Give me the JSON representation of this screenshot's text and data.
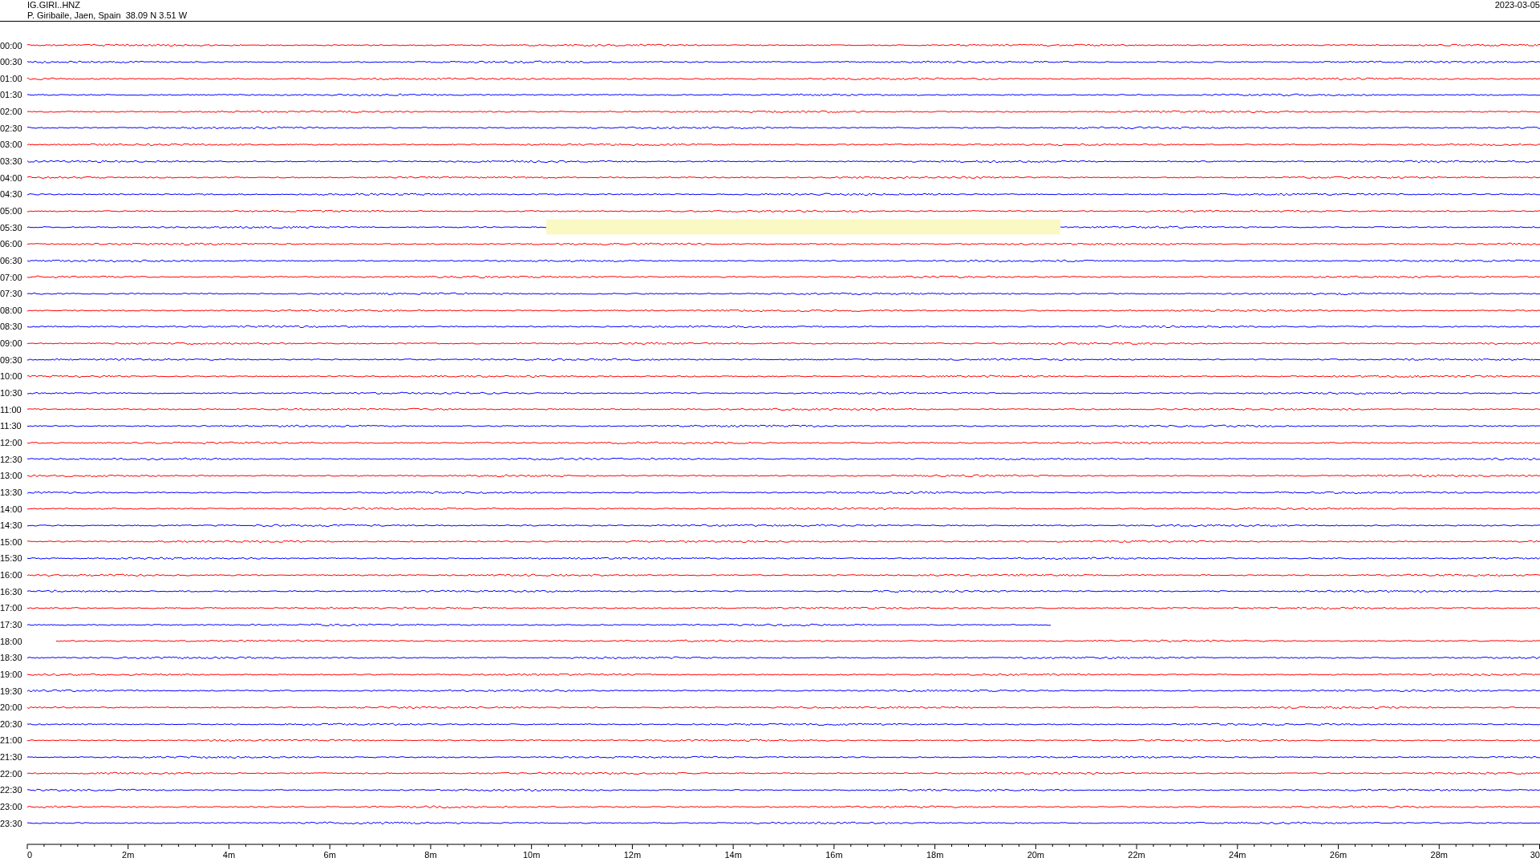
{
  "header": {
    "station": "IG.GIRI..HNZ",
    "location": "P. Giribaile, Jaen, Spain  38.09 N 3.51 W",
    "date": "2023-03-05"
  },
  "rows": [
    {
      "label": "00:00",
      "color": "#ff0000",
      "kind": "full",
      "highlighted": false
    },
    {
      "label": "00:30",
      "color": "#0000ff",
      "kind": "full",
      "highlighted": false
    },
    {
      "label": "01:00",
      "color": "#ff0000",
      "kind": "full",
      "highlighted": false
    },
    {
      "label": "01:30",
      "color": "#0000ff",
      "kind": "full",
      "highlighted": false
    },
    {
      "label": "02:00",
      "color": "#ff0000",
      "kind": "full",
      "highlighted": false
    },
    {
      "label": "02:30",
      "color": "#0000ff",
      "kind": "full",
      "highlighted": false
    },
    {
      "label": "03:00",
      "color": "#ff0000",
      "kind": "full",
      "highlighted": false
    },
    {
      "label": "03:30",
      "color": "#0000ff",
      "kind": "full",
      "highlighted": false
    },
    {
      "label": "04:00",
      "color": "#ff0000",
      "kind": "full",
      "highlighted": false
    },
    {
      "label": "04:30",
      "color": "#0000ff",
      "kind": "full",
      "highlighted": false
    },
    {
      "label": "05:00",
      "color": "#ff0000",
      "kind": "full",
      "highlighted": false
    },
    {
      "label": "05:30",
      "color": "#0000ff",
      "kind": "full",
      "highlighted": true
    },
    {
      "label": "06:00",
      "color": "#ff0000",
      "kind": "full",
      "highlighted": false
    },
    {
      "label": "06:30",
      "color": "#0000ff",
      "kind": "full",
      "highlighted": false
    },
    {
      "label": "07:00",
      "color": "#ff0000",
      "kind": "full",
      "highlighted": false
    },
    {
      "label": "07:30",
      "color": "#0000ff",
      "kind": "full",
      "highlighted": false
    },
    {
      "label": "08:00",
      "color": "#ff0000",
      "kind": "full",
      "highlighted": false
    },
    {
      "label": "08:30",
      "color": "#0000ff",
      "kind": "full",
      "highlighted": false
    },
    {
      "label": "09:00",
      "color": "#ff0000",
      "kind": "full",
      "highlighted": false
    },
    {
      "label": "09:30",
      "color": "#0000ff",
      "kind": "full",
      "highlighted": false
    },
    {
      "label": "10:00",
      "color": "#ff0000",
      "kind": "full",
      "highlighted": false
    },
    {
      "label": "10:30",
      "color": "#0000ff",
      "kind": "full",
      "highlighted": false
    },
    {
      "label": "11:00",
      "color": "#ff0000",
      "kind": "full",
      "highlighted": false
    },
    {
      "label": "11:30",
      "color": "#0000ff",
      "kind": "full",
      "highlighted": false
    },
    {
      "label": "12:00",
      "color": "#ff0000",
      "kind": "full",
      "highlighted": false
    },
    {
      "label": "12:30",
      "color": "#0000ff",
      "kind": "full",
      "highlighted": false
    },
    {
      "label": "13:00",
      "color": "#ff0000",
      "kind": "full",
      "highlighted": false
    },
    {
      "label": "13:30",
      "color": "#0000ff",
      "kind": "full",
      "highlighted": false
    },
    {
      "label": "14:00",
      "color": "#ff0000",
      "kind": "full",
      "highlighted": false
    },
    {
      "label": "14:30",
      "color": "#0000ff",
      "kind": "full",
      "highlighted": false
    },
    {
      "label": "15:00",
      "color": "#ff0000",
      "kind": "full",
      "highlighted": false
    },
    {
      "label": "15:30",
      "color": "#0000ff",
      "kind": "full",
      "highlighted": false
    },
    {
      "label": "16:00",
      "color": "#ff0000",
      "kind": "full",
      "highlighted": false
    },
    {
      "label": "16:30",
      "color": "#0000ff",
      "kind": "full",
      "highlighted": false
    },
    {
      "label": "17:00",
      "color": "#ff0000",
      "kind": "full",
      "highlighted": false
    },
    {
      "label": "17:30",
      "color": "#0000ff",
      "kind": "ends-early",
      "highlighted": false
    },
    {
      "label": "18:00",
      "color": "#ff0000",
      "kind": "starts-late",
      "highlighted": false
    },
    {
      "label": "18:30",
      "color": "#0000ff",
      "kind": "full",
      "highlighted": false
    },
    {
      "label": "19:00",
      "color": "#ff0000",
      "kind": "full",
      "highlighted": false
    },
    {
      "label": "19:30",
      "color": "#0000ff",
      "kind": "full",
      "highlighted": false
    },
    {
      "label": "20:00",
      "color": "#ff0000",
      "kind": "full",
      "highlighted": false
    },
    {
      "label": "20:30",
      "color": "#0000ff",
      "kind": "full",
      "highlighted": false
    },
    {
      "label": "21:00",
      "color": "#ff0000",
      "kind": "full",
      "highlighted": false
    },
    {
      "label": "21:30",
      "color": "#0000ff",
      "kind": "full",
      "highlighted": false
    },
    {
      "label": "22:00",
      "color": "#ff0000",
      "kind": "full",
      "highlighted": false
    },
    {
      "label": "22:30",
      "color": "#0000ff",
      "kind": "full",
      "highlighted": false
    },
    {
      "label": "23:00",
      "color": "#ff0000",
      "kind": "full",
      "highlighted": false
    },
    {
      "label": "23:30",
      "color": "#0000ff",
      "kind": "full",
      "highlighted": false
    }
  ],
  "axis": {
    "labels": [
      "0",
      "2m",
      "4m",
      "6m",
      "8m",
      "10m",
      "12m",
      "14m",
      "16m",
      "18m",
      "20m",
      "22m",
      "24m",
      "26m",
      "28m",
      "30"
    ]
  }
}
